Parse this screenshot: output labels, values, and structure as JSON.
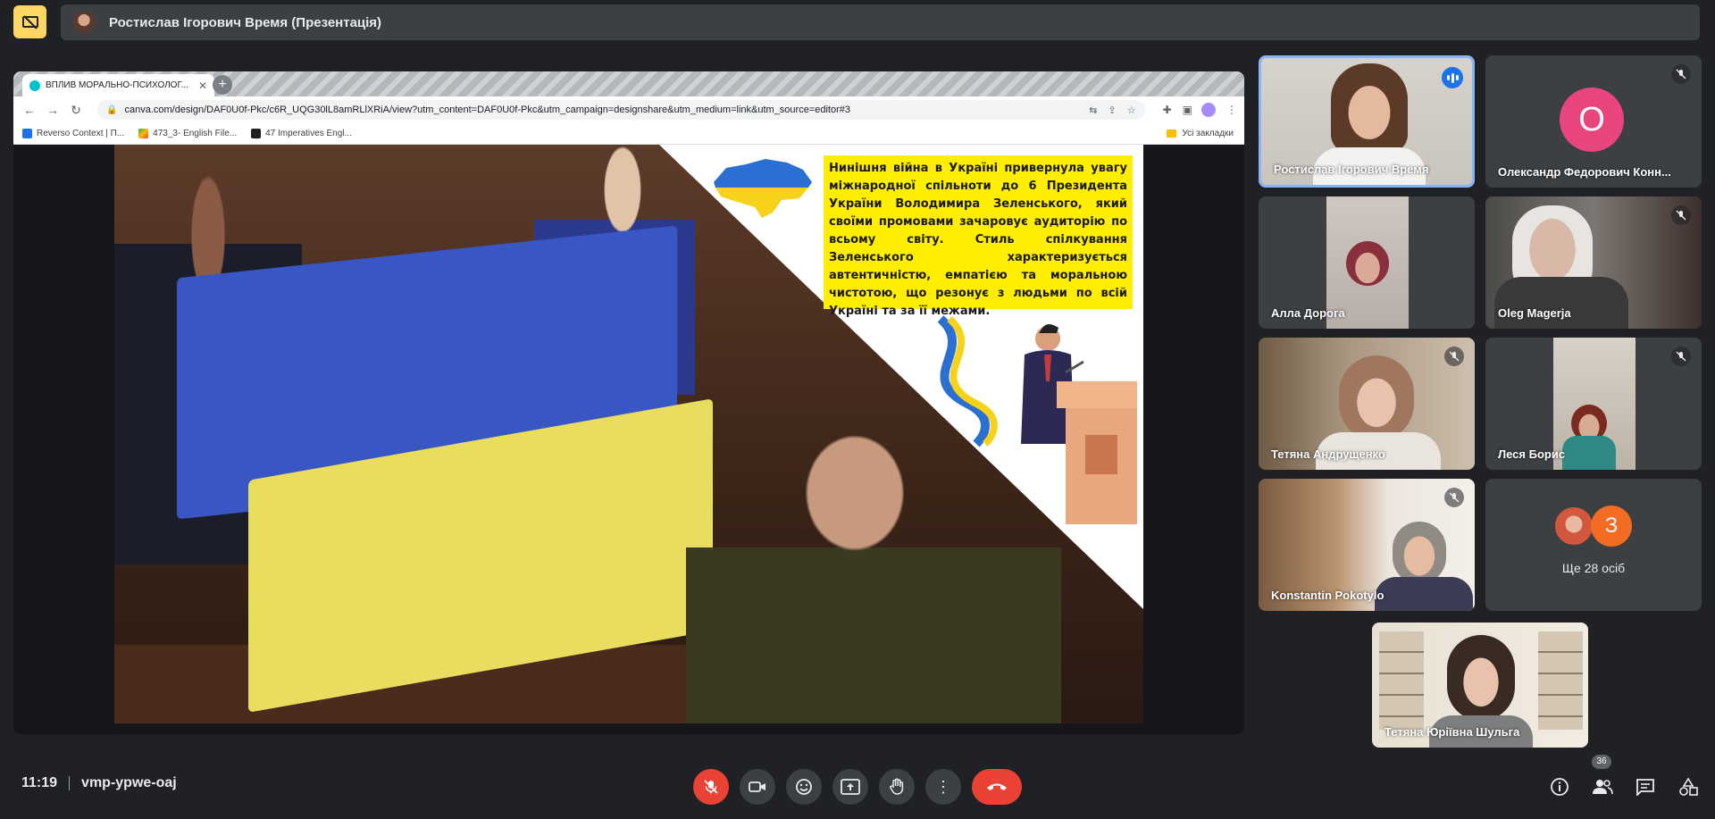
{
  "header": {
    "meeting_title": "Ростислав Ігорович Время (Презентація)"
  },
  "browser": {
    "tab_title": "ВПЛИВ МОРАЛЬНО-ПСИХОЛОГ...",
    "url": "canva.com/design/DAF0U0f-Pkc/c6R_UQG30lL8amRLlXRiA/view?utm_content=DAF0U0f-Pkc&utm_campaign=designshare&utm_medium=link&utm_source=editor#3",
    "bookmarks": [
      {
        "label": "Reverso Context | П..."
      },
      {
        "label": "473_3- English File..."
      },
      {
        "label": "47 Imperatives Engl..."
      }
    ],
    "bookmarks_folder": "Усі закладки"
  },
  "slide": {
    "text": "Нинішня війна в Україні привернула увагу міжнародної спільноти до 6 Президента України Володимира Зеленського, який своїми промовами зачаровує аудиторію по всьому світу. Стиль спілкування Зеленського характеризується автентичністю, емпатією та моральною чистотою, що резонує з людьми по всій Україні та за її межами."
  },
  "participants": [
    {
      "name": "Ростислав Ігорович Время",
      "state": "speaking"
    },
    {
      "name": "Олександр Федорович Конн...",
      "state": "muted",
      "initial": "О"
    },
    {
      "name": "Алла Дорога",
      "state": "video"
    },
    {
      "name": "Oleg Magerja",
      "state": "muted"
    },
    {
      "name": "Тетяна Андрущенко",
      "state": "muted"
    },
    {
      "name": "Леся Борис",
      "state": "muted"
    },
    {
      "name": "Konstantin Pokotylo",
      "state": "muted"
    }
  ],
  "more": {
    "initial": "З",
    "label": "Ще 28 осіб"
  },
  "self_view": {
    "name": "Тетяна Юріївна Шульга"
  },
  "footer": {
    "time": "11:19",
    "meeting_code": "vmp-ypwe-oaj",
    "people_count": "36"
  },
  "colors": {
    "background": "#202124",
    "tile": "#3c4043",
    "accent_blue": "#8ab4f8",
    "danger_red": "#ea4335",
    "present_yellow": "#fdd663"
  },
  "icons": [
    "present-off-icon",
    "mic-off-icon",
    "camera-icon",
    "emoji-icon",
    "present-screen-icon",
    "raise-hand-icon",
    "more-vert-icon",
    "hang-up-icon",
    "info-icon",
    "people-icon",
    "chat-icon",
    "activities-icon"
  ]
}
